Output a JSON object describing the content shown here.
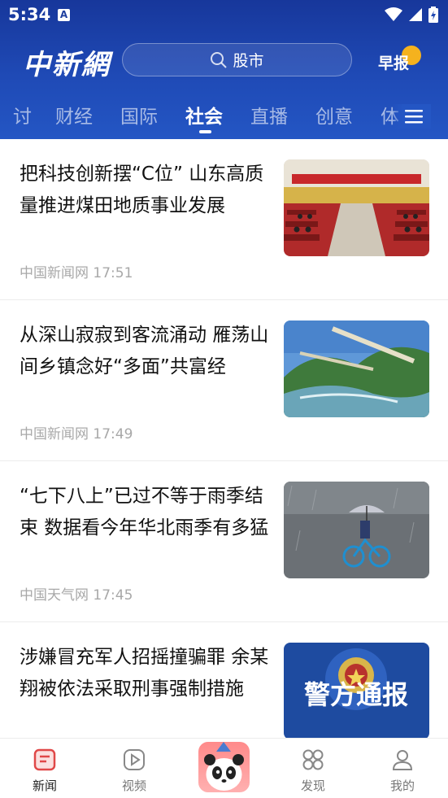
{
  "status": {
    "time": "5:34",
    "notif_icon": "A"
  },
  "header": {
    "logo": "中新網",
    "search": {
      "placeholder": "股市"
    },
    "morning_report": "早报"
  },
  "tabs": [
    {
      "label": "讨"
    },
    {
      "label": "财经"
    },
    {
      "label": "国际"
    },
    {
      "label": "社会",
      "active": true
    },
    {
      "label": "直播"
    },
    {
      "label": "创意"
    },
    {
      "label": "体"
    }
  ],
  "feed": [
    {
      "title": "把科技创新摆“C位” 山东高质量推进煤田地质事业发展",
      "source": "中国新闻网",
      "time": "17:51",
      "thumb": "conference-hall"
    },
    {
      "title": "从深山寂寂到客流涌动 雁荡山间乡镇念好“多面”共富经",
      "source": "中国新闻网",
      "time": "17:49",
      "thumb": "mountain-river"
    },
    {
      "title": "“七下八上”已过不等于雨季结束 数据看今年华北雨季有多猛",
      "source": "中国天气网",
      "time": "17:45",
      "thumb": "rain-cyclist"
    },
    {
      "title": "涉嫌冒充军人招摇撞骗罪 余某翔被依法采取刑事强制措施",
      "source": "",
      "time": "",
      "thumb": "police-notice",
      "thumb_text": "警方通报"
    }
  ],
  "tabbar": [
    {
      "label": "新闻",
      "icon": "news-icon",
      "active": true
    },
    {
      "label": "视频",
      "icon": "video-icon"
    },
    {
      "label": "",
      "icon": "panda-icon"
    },
    {
      "label": "发现",
      "icon": "discover-icon"
    },
    {
      "label": "我的",
      "icon": "profile-icon"
    }
  ],
  "colors": {
    "header_top": "#17379b",
    "header_bottom": "#2456c4",
    "accent_red": "#e04848",
    "badge": "#f5b21e"
  }
}
